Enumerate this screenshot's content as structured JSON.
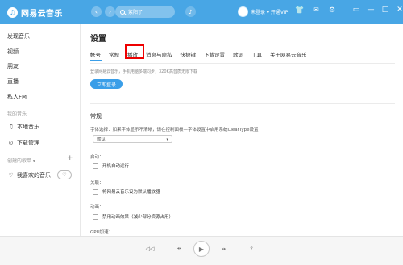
{
  "app": {
    "title": "网易云音乐",
    "logo_glyph": "♫",
    "accent": "#48a6e5"
  },
  "topbar": {
    "back_glyph": "‹",
    "forward_glyph": "›",
    "search_value": "紫阳了",
    "mic_glyph": "♪",
    "user_text": "未登录 ▾ 开通VIP",
    "icons": [
      "shirt-icon",
      "mail-icon",
      "settings-icon",
      "screen-icon"
    ],
    "icon_glyphs": [
      "👕",
      "✉",
      "⚙",
      "▭"
    ],
    "win_glyphs": [
      "▭",
      "—",
      "□",
      "✕"
    ]
  },
  "sidebar": {
    "items": [
      {
        "label": "发现音乐"
      },
      {
        "label": "视频"
      },
      {
        "label": "朋友"
      },
      {
        "label": "直播"
      },
      {
        "label": "私人FM"
      }
    ],
    "my_music_head": "我的音乐",
    "local_music": "本地音乐",
    "local_glyph": "♫",
    "download": "下载管理",
    "download_glyph": "⊙",
    "playlist_head": "创建的歌单 ▾",
    "plus_glyph": "+",
    "liked": "我喜欢的音乐",
    "liked_glyph": "♡",
    "heart_btn_glyph": "♡"
  },
  "main": {
    "title": "设置",
    "tabs": [
      "帐号",
      "常规",
      "播放",
      "消息与隐私",
      "快捷键",
      "下载设置",
      "歌词",
      "工具",
      "关于网易云音乐"
    ],
    "login_hint": "登录网易云音乐，手机电脑多端同步，320K高音质无限下载",
    "login_btn": "立即登录",
    "section_title": "常规",
    "font_label": "字体选择：如果字体显示不清晰，请在控制面板—字体设置中启用系统ClearType设置",
    "font_value": "默认",
    "select_arrow": "▾",
    "startup_label": "启动：",
    "startup_option": "开机自动运行",
    "assoc_label": "关联：",
    "assoc_option": "将网易云音乐设为默认播放器",
    "anim_label": "动画：",
    "anim_option": "禁用动画效果（减少部分资源占用）",
    "gpu_label": "GPU加速："
  },
  "player": {
    "prev_glyph": "◁◁",
    "skip_back_glyph": "⏮",
    "play_glyph": "▶",
    "skip_next_glyph": "⏭",
    "share_glyph": "⇪"
  }
}
